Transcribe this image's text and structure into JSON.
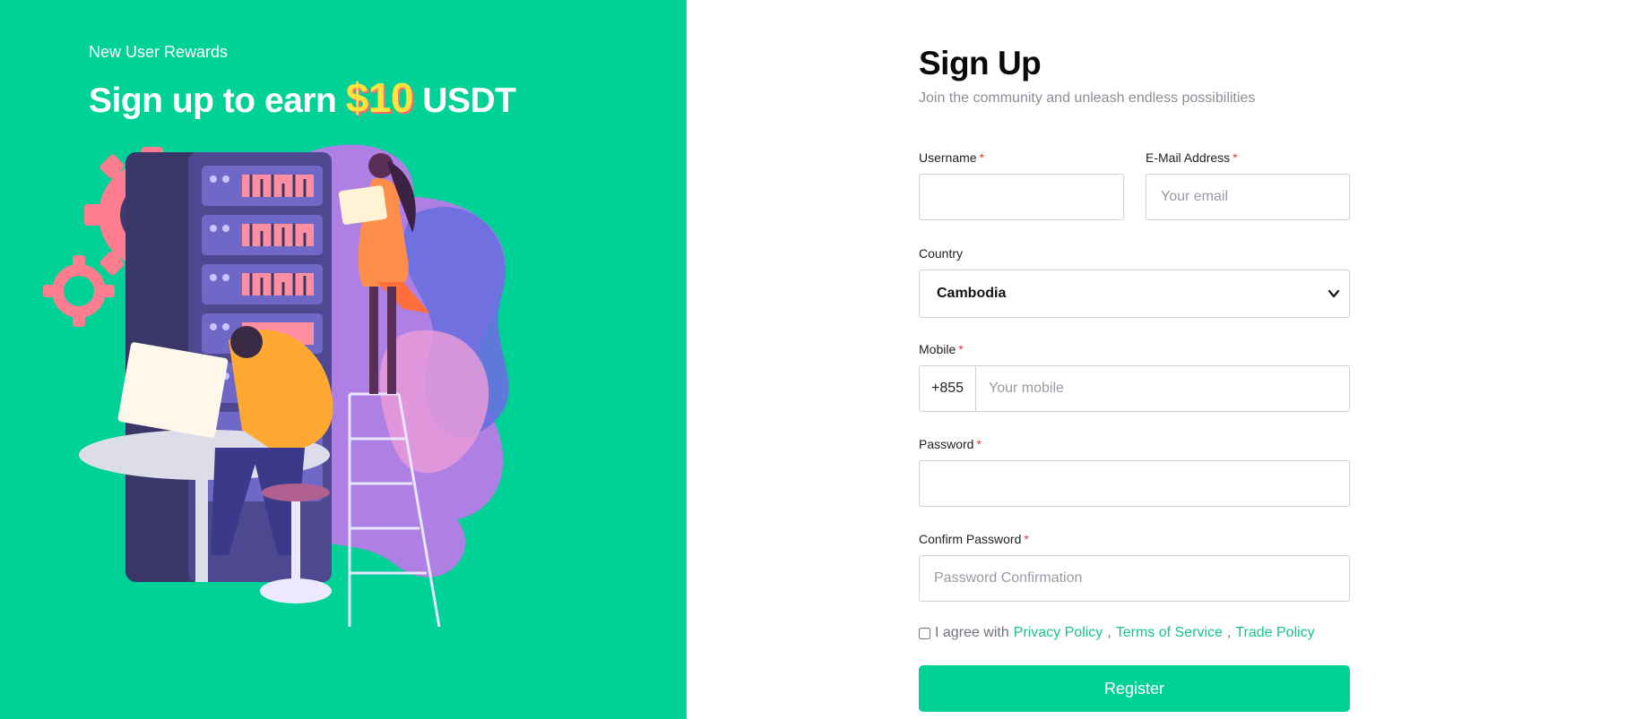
{
  "promo": {
    "eyebrow": "New User Rewards",
    "headline_prefix": "Sign up to earn",
    "headline_amount": "$10",
    "headline_suffix": "USDT",
    "background_color": "#00d196",
    "amount_color": "#ffe23b"
  },
  "form": {
    "title": "Sign Up",
    "subtitle": "Join the community and unleash endless possibilities",
    "required_mark": "*",
    "username": {
      "label": "Username",
      "value": "",
      "placeholder": ""
    },
    "email": {
      "label": "E-Mail Address",
      "value": "",
      "placeholder": "Your email"
    },
    "country": {
      "label": "Country",
      "selected": "Cambodia"
    },
    "mobile": {
      "label": "Mobile",
      "dial_code": "+855",
      "value": "",
      "placeholder": "Your mobile"
    },
    "password": {
      "label": "Password",
      "value": "",
      "placeholder": ""
    },
    "confirm_password": {
      "label": "Confirm Password",
      "value": "",
      "placeholder": "Password Confirmation"
    },
    "agree": {
      "prefix": "I agree with",
      "privacy_policy": "Privacy Policy",
      "terms_of_service": "Terms of Service",
      "trade_policy": "Trade Policy",
      "separator": ",",
      "checked": false
    },
    "register_label": "Register",
    "accent_color": "#00d196",
    "link_color": "#15c58d"
  }
}
